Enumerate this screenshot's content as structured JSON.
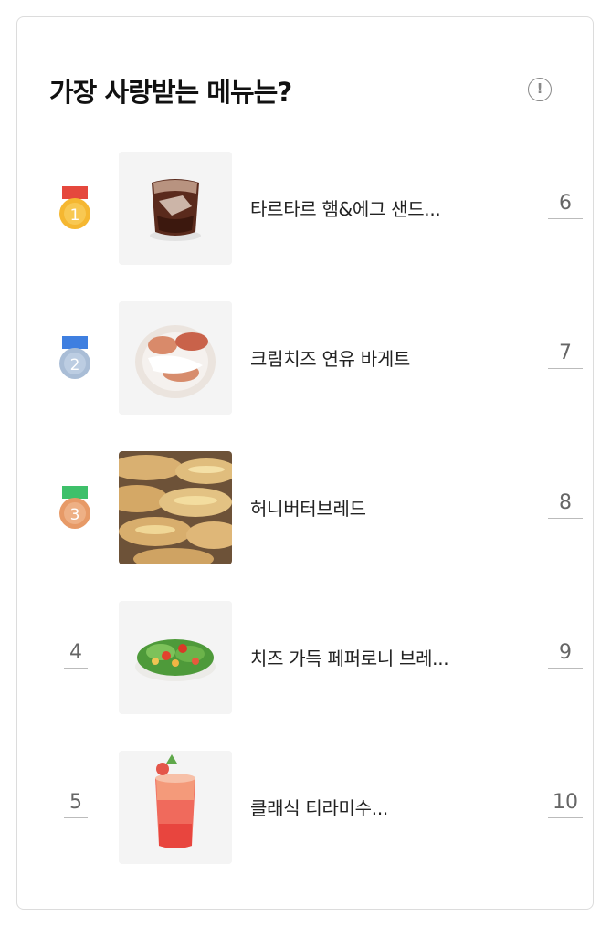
{
  "header": {
    "title": "가장 사랑받는 메뉴는?",
    "info_icon": "info-icon",
    "info_glyph": "!"
  },
  "ranking": [
    {
      "rank": "1",
      "name": "타르타르 햄&에그 샌드...",
      "side_rank": "6",
      "medal": "gold-medal-icon"
    },
    {
      "rank": "2",
      "name": "크림치즈 연유 바게트",
      "side_rank": "7",
      "medal": "silver-medal-icon"
    },
    {
      "rank": "3",
      "name": "허니버터브레드",
      "side_rank": "8",
      "medal": "bronze-medal-icon"
    },
    {
      "rank": "4",
      "name": "치즈 가득 페퍼로니 브레...",
      "side_rank": "9"
    },
    {
      "rank": "5",
      "name": "클래식 티라미수...",
      "side_rank": "10"
    }
  ],
  "colors": {
    "gold": "#f5b731",
    "silver": "#a9bdd6",
    "bronze": "#e79a67",
    "ribbon_red": "#e5483d",
    "ribbon_blue": "#3f7fe0",
    "ribbon_green": "#3ec06a"
  }
}
